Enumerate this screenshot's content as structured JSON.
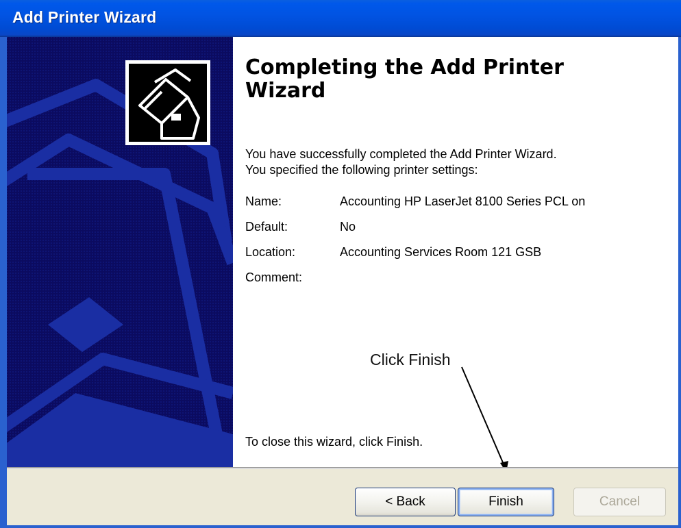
{
  "window": {
    "title": "Add Printer Wizard"
  },
  "main": {
    "heading": "Completing the Add Printer Wizard",
    "intro_line1": "You have successfully completed the Add Printer Wizard.",
    "intro_line2": "You specified the following printer settings:",
    "settings": [
      {
        "label": "Name:",
        "value": "Accounting HP LaserJet 8100 Series PCL on"
      },
      {
        "label": "Default:",
        "value": "No"
      },
      {
        "label": "Location:",
        "value": "Accounting Services Room 121 GSB"
      },
      {
        "label": "Comment:",
        "value": ""
      }
    ],
    "annotation": "Click Finish",
    "close_hint": "To close this wizard, click Finish."
  },
  "buttons": {
    "back": "< Back",
    "finish": "Finish",
    "cancel": "Cancel"
  },
  "icons": {
    "banner": "printer-wizard-watermark",
    "logo": "printer-icon"
  },
  "colors": {
    "titlebar": "#0153e2",
    "banner": "#0a0a5e",
    "button_bar": "#ece9d8"
  }
}
